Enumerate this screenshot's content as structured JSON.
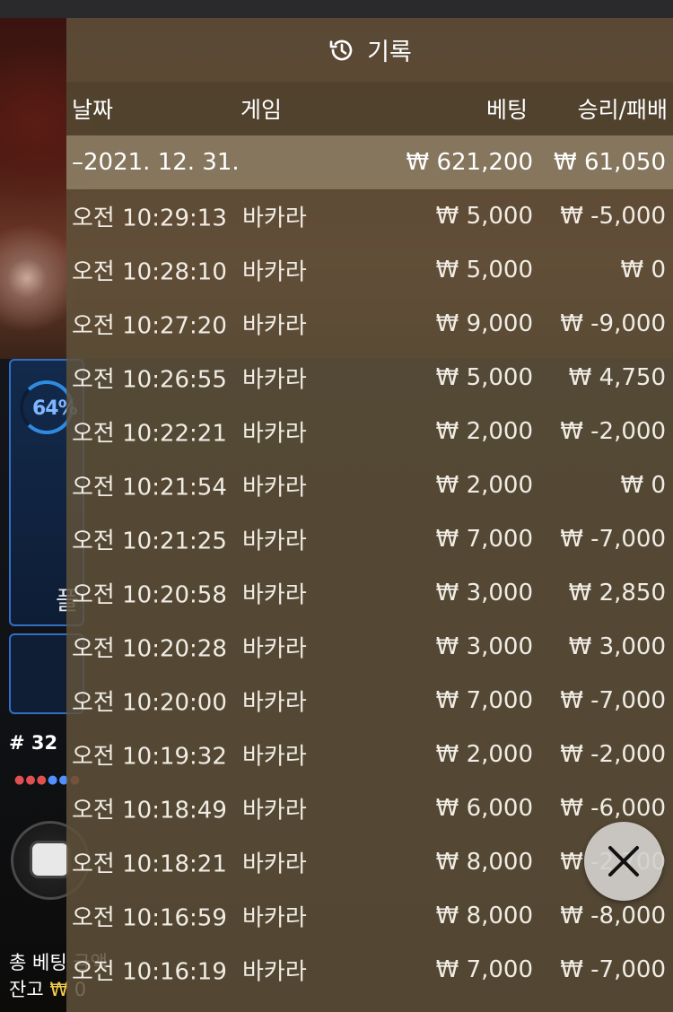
{
  "background": {
    "win_rate": "64%",
    "glyph": "플",
    "round": "# 32",
    "bottom_line1": "총 베팅 금액",
    "bottom_line2_label": "잔고",
    "bottom_line2_won": "₩",
    "bottom_line2_value": "0"
  },
  "history": {
    "title": "기록",
    "columns": {
      "date": "날짜",
      "game": "게임",
      "bet": "베팅",
      "result": "승리/패배"
    },
    "summary": {
      "date": "–2021. 12. 31.",
      "bet": "₩ 621,200",
      "result": "₩ 61,050"
    },
    "rows": [
      {
        "time": "오전 10:29:13",
        "game": "바카라",
        "bet": "₩ 5,000",
        "result": "₩ -5,000"
      },
      {
        "time": "오전 10:28:10",
        "game": "바카라",
        "bet": "₩ 5,000",
        "result": "₩ 0"
      },
      {
        "time": "오전 10:27:20",
        "game": "바카라",
        "bet": "₩ 9,000",
        "result": "₩ -9,000"
      },
      {
        "time": "오전 10:26:55",
        "game": "바카라",
        "bet": "₩ 5,000",
        "result": "₩ 4,750"
      },
      {
        "time": "오전 10:22:21",
        "game": "바카라",
        "bet": "₩ 2,000",
        "result": "₩ -2,000"
      },
      {
        "time": "오전 10:21:54",
        "game": "바카라",
        "bet": "₩ 2,000",
        "result": "₩ 0"
      },
      {
        "time": "오전 10:21:25",
        "game": "바카라",
        "bet": "₩ 7,000",
        "result": "₩ -7,000"
      },
      {
        "time": "오전 10:20:58",
        "game": "바카라",
        "bet": "₩ 3,000",
        "result": "₩ 2,850"
      },
      {
        "time": "오전 10:20:28",
        "game": "바카라",
        "bet": "₩ 3,000",
        "result": "₩ 3,000"
      },
      {
        "time": "오전 10:20:00",
        "game": "바카라",
        "bet": "₩ 7,000",
        "result": "₩ -7,000"
      },
      {
        "time": "오전 10:19:32",
        "game": "바카라",
        "bet": "₩ 2,000",
        "result": "₩ -2,000"
      },
      {
        "time": "오전 10:18:49",
        "game": "바카라",
        "bet": "₩ 6,000",
        "result": "₩ -6,000"
      },
      {
        "time": "오전 10:18:21",
        "game": "바카라",
        "bet": "₩ 8,000",
        "result": "₩ -2,700"
      },
      {
        "time": "오전 10:16:59",
        "game": "바카라",
        "bet": "₩ 8,000",
        "result": "₩ -8,000"
      },
      {
        "time": "오전 10:16:19",
        "game": "바카라",
        "bet": "₩ 7,000",
        "result": "₩ -7,000"
      }
    ]
  },
  "icons": {
    "history": "history-clock-icon",
    "close": "close-icon"
  }
}
